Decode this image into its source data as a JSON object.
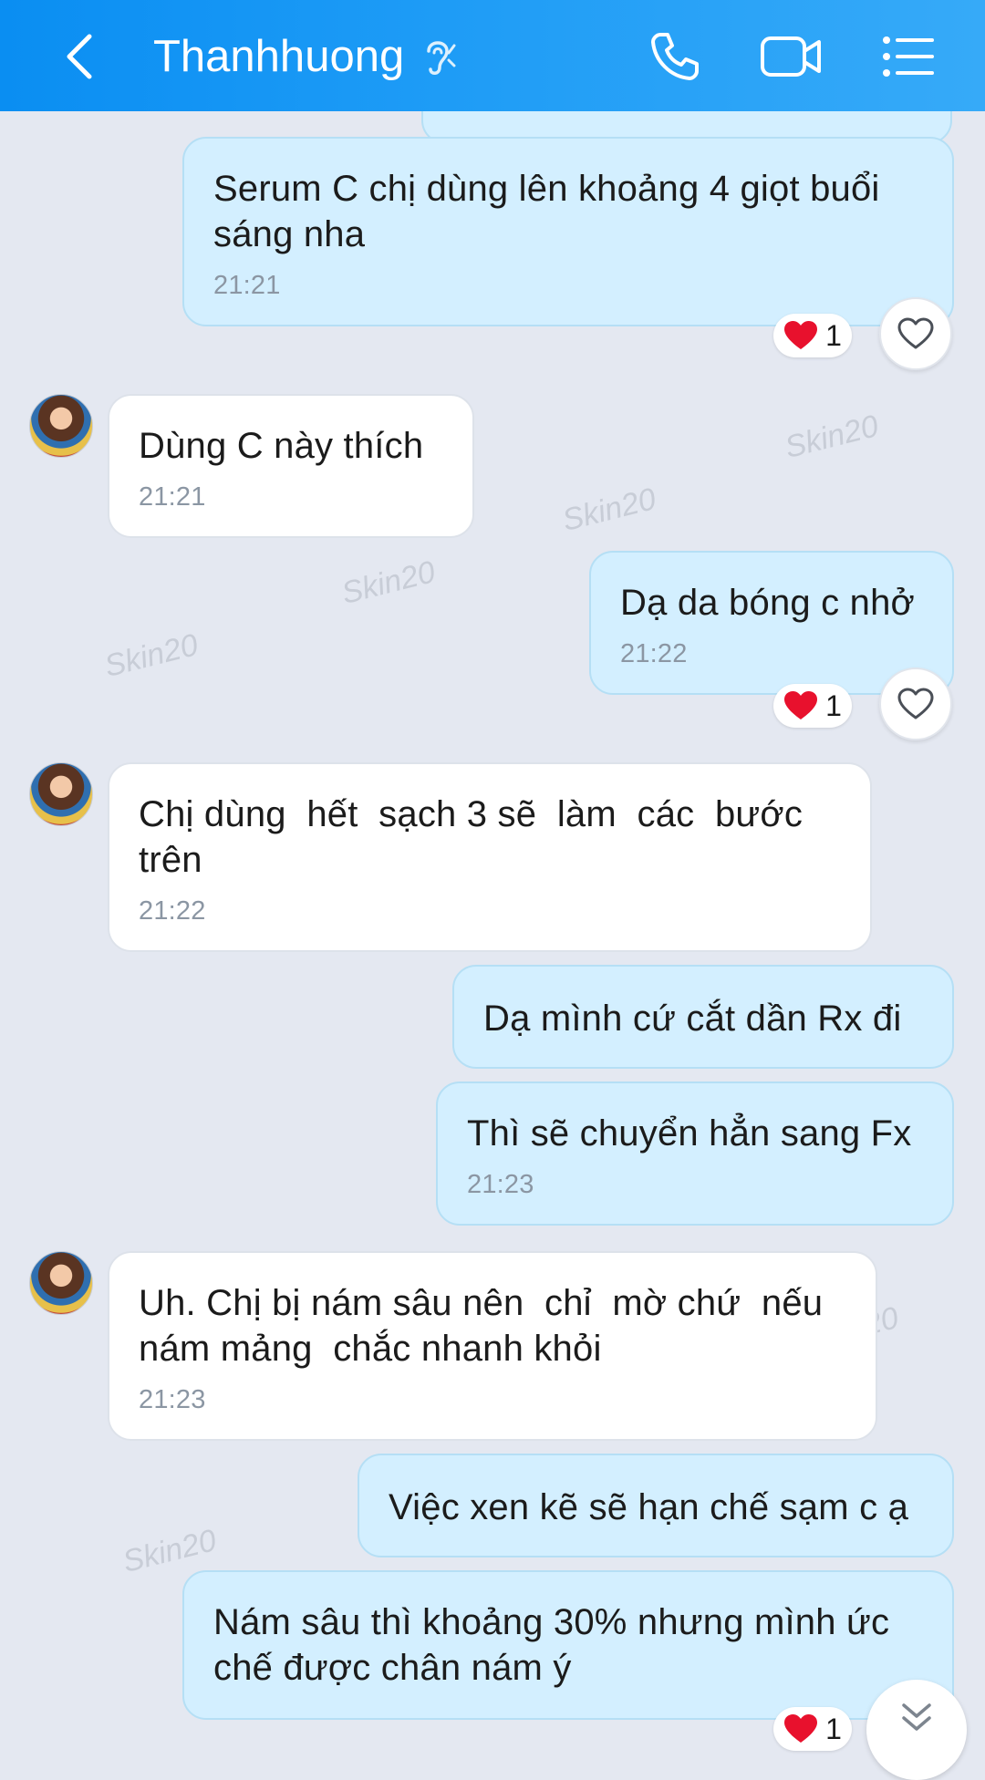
{
  "header": {
    "back_icon": "chevron-left-icon",
    "contact_name": "Thanhhuong",
    "icons": [
      "ear-icon",
      "phone-icon",
      "video-call-icon",
      "menu-list-icon"
    ]
  },
  "colors": {
    "header_gradient_start": "#0a8ef2",
    "header_gradient_end": "#36aaf8",
    "chat_background": "#e4e8f1",
    "outgoing_bubble": "#d3efff",
    "incoming_bubble": "#ffffff",
    "timestamp": "#8b96a3",
    "reaction_heart": "#e8112d"
  },
  "messages": [
    {
      "direction": "out",
      "text": "Serum C chị dùng lên khoảng 4 giọt buổi\nsáng nha",
      "time": "21:21",
      "reaction": {
        "icon": "heart-icon",
        "count": "1"
      }
    },
    {
      "direction": "in",
      "text": "Dùng C này thích",
      "time": "21:21"
    },
    {
      "direction": "out",
      "text": "Dạ da bóng c nhở",
      "time": "21:22",
      "reaction": {
        "icon": "heart-icon",
        "count": "1"
      }
    },
    {
      "direction": "in",
      "text": "Chị dùng  hết  sạch 3 sẽ  làm  các  bước\ntrên",
      "time": "21:22"
    },
    {
      "direction": "out",
      "text": "Dạ mình cứ cắt dần Rx đi",
      "time": ""
    },
    {
      "direction": "out",
      "text": "Thì sẽ chuyển hẳn sang Fx",
      "time": "21:23"
    },
    {
      "direction": "in",
      "text": "Uh. Chị bị nám sâu nên  chỉ  mờ chứ  nếu\nnám mảng  chắc nhanh khỏi",
      "time": "21:23"
    },
    {
      "direction": "out",
      "text": "Việc xen kẽ sẽ hạn chế sạm c ạ",
      "time": ""
    },
    {
      "direction": "out",
      "text": "Nám sâu thì khoảng 30% nhưng mình ức\nchế được chân nám ý",
      "time": "",
      "reaction": {
        "icon": "heart-icon",
        "count": "1"
      }
    }
  ],
  "watermark_text": "Skin20"
}
